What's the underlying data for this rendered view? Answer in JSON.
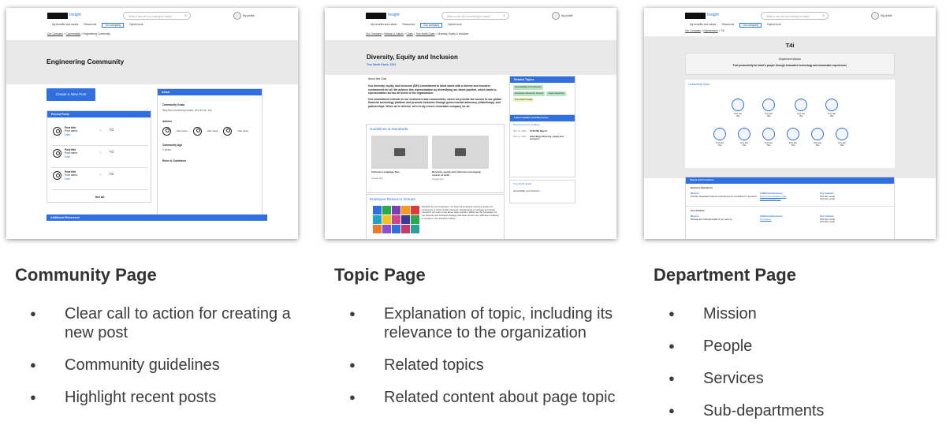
{
  "header": {
    "logo_text": "Insight",
    "search_placeholder": "What or who are you looking for today?",
    "profile_label": "My profile",
    "nav": [
      "My benefits and career",
      "Resources",
      "Our company",
      "Hybrid work"
    ]
  },
  "community_page": {
    "breadcrumb": [
      "Our Company",
      "Communities",
      "Engineering Community"
    ],
    "title": "Engineering Community",
    "create_button": "Create a New Post",
    "recent_posts_header": "Recent Posts",
    "posts": [
      {
        "title": "Post title",
        "author": "Post name",
        "date": "Date"
      },
      {
        "title": "Post title",
        "author": "Post name",
        "date": "Date"
      },
      {
        "title": "Post title",
        "author": "Post name",
        "date": "Date"
      }
    ],
    "see_all": "See All",
    "about_header": "About",
    "community_goals_label": "Community Goals",
    "community_goals_text": "Why this community exists, who it's for, etc.",
    "admins_label": "Admins",
    "admins": [
      "User name",
      "User name",
      "User name"
    ],
    "community_age_label": "Community Age",
    "community_age_value": "2 years",
    "rules_label": "Rules & Guidelines",
    "additional_resources": "Additional Resources"
  },
  "topic_page": {
    "breadcrumb": [
      "Our Company",
      "Mission & Values",
      "Goals",
      "True North Goals",
      "Diversity, Equity & Inclusion"
    ],
    "title": "Diversity, Equity and Inclusion",
    "subtitle": "True North Goals: 2024",
    "about_label": "About this Goal",
    "about_p1": "Our diversity, equity, and inclusion (DEI) commitment at Intuit starts with a diverse and inclusive environment for all. We achieve this representation by diversifying our talent pipeline, which leads to representation across all levels of the organization.",
    "about_p2": "Our commitment extends to our customers and communities, where we provide fair access to our global financial technology platform and promote inclusion through governmental advocacy, philanthropy, and partnerships. When we're diverse, we're truly a more innovative company for all.",
    "guidelines_header": "Guidelines & Standards",
    "cards": [
      {
        "title": "Inclusive Language Tips",
        "source": "Google Doc"
      },
      {
        "title": "Diversity, equity and inclusion messaging source of truth",
        "source": "Google Doc"
      }
    ],
    "erg_header": "Employee Resource Groups",
    "erg_text": "Modeled by our employees, we have 14 employee resource groups for employees to share similar interests, backgrounds or heritage and where members can learn more about other cultures. ERGs lay the foundation for our diversity and inclusion strategy and have proven very effective in helping to create a more inclusive culture.",
    "related_topics_header": "Related Topics",
    "related_topics": [
      "Accessibility and Inclusion",
      "Employee Resource Groups",
      "Apprenticeships",
      "True North Goals"
    ],
    "latest_header": "Latest Updates and Resources",
    "latest_sub": "Resources From & Blogs",
    "latest_items": [
      {
        "date": "Mar 12, 2024",
        "title": "FY23 DEI Report"
      },
      {
        "date": "Mar 12, 2024",
        "title": "Intuit Blog: Diversity, equity and inclusion"
      }
    ],
    "goals_label": "True North Goals",
    "goals_value": "Accessibility and Inclusion"
  },
  "department_page": {
    "breadcrumb": [
      "Our Company",
      "Departments",
      "T4i"
    ],
    "title": "T4i",
    "mission_label": "Department Mission",
    "mission_text": "Fuel productivity for Intuit's people through innovative technology and memorable experiences",
    "leadership_label": "Leadership Team",
    "leaders_row1": [
      {
        "name": "First last",
        "role": "Title"
      },
      {
        "name": "First last",
        "role": "Title"
      },
      {
        "name": "First last",
        "role": "Title"
      },
      {
        "name": "First last",
        "role": "Title"
      }
    ],
    "leaders_row2": [
      {
        "name": "First last",
        "role": "Title"
      },
      {
        "name": "First last",
        "role": "Title"
      },
      {
        "name": "First last",
        "role": "Title"
      },
      {
        "name": "First last",
        "role": "Title"
      },
      {
        "name": "First last",
        "role": "Title"
      },
      {
        "name": "First last",
        "role": "Title"
      }
    ],
    "teams_header": "Teams and Functions",
    "teams": [
      {
        "name": "Business Operations",
        "mission": "Provide integrated business experiences for centralized IT functions",
        "resources": [
          "Tech Communications Site",
          "Tech Knowledge Hub"
        ],
        "contacts": [
          "First last, email",
          "First last, email"
        ]
      },
      {
        "name": "Core Finance",
        "mission": "Manage the financial health of our team by",
        "resources": [
          "T4i Finance"
        ],
        "contacts": [
          "First last, email",
          "First last, email"
        ]
      }
    ],
    "col_labels": [
      "Mission",
      "Additional Resources",
      "Key Contacts"
    ]
  },
  "captions": [
    {
      "title": "Community Page",
      "bullets": [
        "Clear call to action for creating a new post",
        "Community guidelines",
        "Highlight recent posts"
      ]
    },
    {
      "title": "Topic Page",
      "bullets": [
        "Explanation of topic, including its relevance to the organization",
        "Related topics",
        "Related content about page topic"
      ]
    },
    {
      "title": "Department Page",
      "bullets": [
        "Mission",
        "People",
        "Services",
        "Sub-departments"
      ]
    }
  ],
  "colors": {
    "accent_blue": "#2f6fe0",
    "banner_gray": "#e9e9e9",
    "tag_green": "#b9e6c4"
  }
}
